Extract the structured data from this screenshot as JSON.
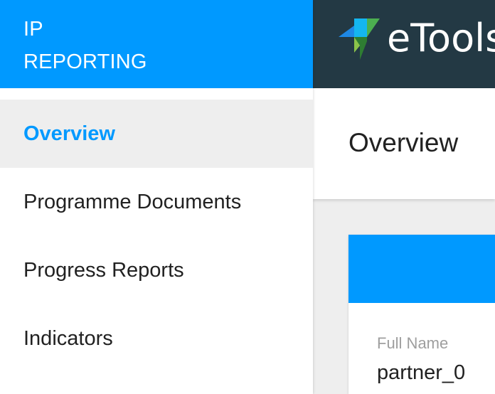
{
  "app": {
    "brand_line1": "IP",
    "brand_line2": "REPORTING",
    "logo_text": "eTools",
    "accent_color": "#0099ff",
    "topbar_color": "#233944"
  },
  "sidebar": {
    "items": [
      {
        "label": "Overview",
        "active": true
      },
      {
        "label": "Programme Documents",
        "active": false
      },
      {
        "label": "Progress Reports",
        "active": false
      },
      {
        "label": "Indicators",
        "active": false
      }
    ]
  },
  "page": {
    "title": "Overview"
  },
  "profile_card": {
    "full_name_label": "Full Name",
    "full_name_value": "partner_0"
  }
}
